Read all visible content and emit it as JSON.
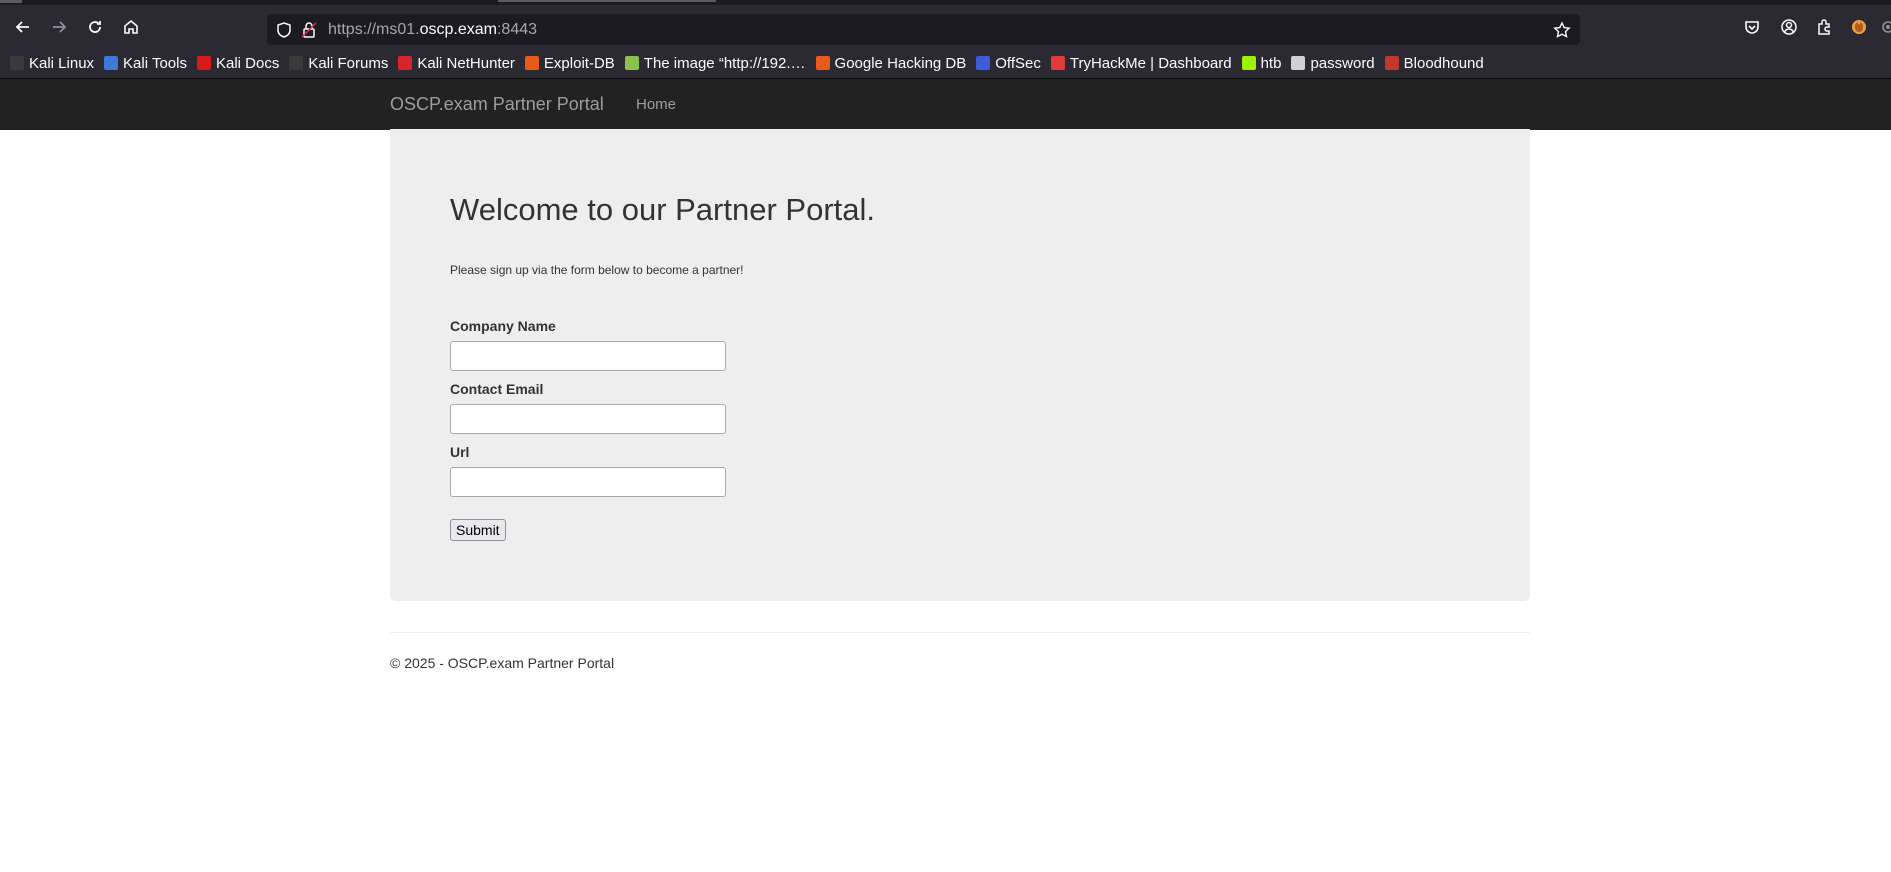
{
  "browser": {
    "url_prefix": "https://ms01.",
    "url_domain": "oscp.exam",
    "url_port": ":8443",
    "bookmarks": [
      {
        "label": "Kali Linux",
        "color": "#3b3b3b"
      },
      {
        "label": "Kali Tools",
        "color": "#3d7bd9"
      },
      {
        "label": "Kali Docs",
        "color": "#d91a1a"
      },
      {
        "label": "Kali Forums",
        "color": "#3b3b3b"
      },
      {
        "label": "Kali NetHunter",
        "color": "#d9232d"
      },
      {
        "label": "Exploit-DB",
        "color": "#e8591a"
      },
      {
        "label": "The image “http://192.…",
        "color": "#8bc34a"
      },
      {
        "label": "Google Hacking DB",
        "color": "#e8591a"
      },
      {
        "label": "OffSec",
        "color": "#3d5bd9"
      },
      {
        "label": "TryHackMe | Dashboard",
        "color": "#e03a3a"
      },
      {
        "label": "htb",
        "color": "#9fef00"
      },
      {
        "label": "password",
        "color": "#cfcfd8"
      },
      {
        "label": "Bloodhound",
        "color": "#c0392b"
      }
    ]
  },
  "nav": {
    "brand": "OSCP.exam Partner Portal",
    "home": "Home"
  },
  "main": {
    "heading": "Welcome to our Partner Portal.",
    "lead": "Please sign up via the form below to become a partner!",
    "form": {
      "company_label": "Company Name",
      "email_label": "Contact Email",
      "url_label": "Url",
      "submit_label": "Submit"
    }
  },
  "footer": {
    "text": "© 2025 - OSCP.exam Partner Portal"
  }
}
